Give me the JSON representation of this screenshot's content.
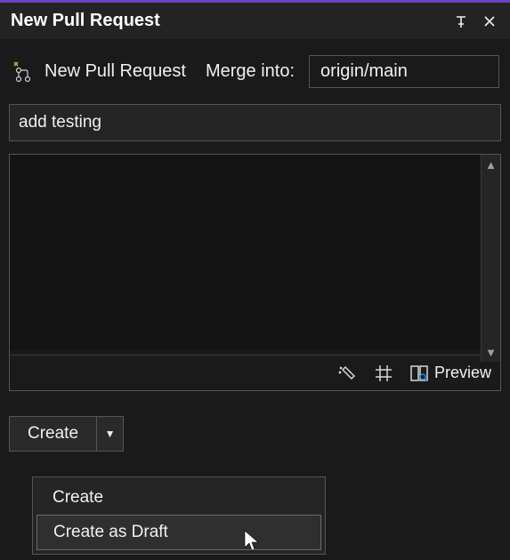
{
  "titlebar": {
    "title": "New Pull Request"
  },
  "header": {
    "label": "New Pull Request",
    "merge_into_label": "Merge into:",
    "target_branch": "origin/main"
  },
  "form": {
    "title_value": "add testing",
    "description_value": ""
  },
  "toolbar": {
    "preview_label": "Preview"
  },
  "create": {
    "button_label": "Create",
    "menu": {
      "item_create": "Create",
      "item_create_draft": "Create as Draft"
    }
  }
}
